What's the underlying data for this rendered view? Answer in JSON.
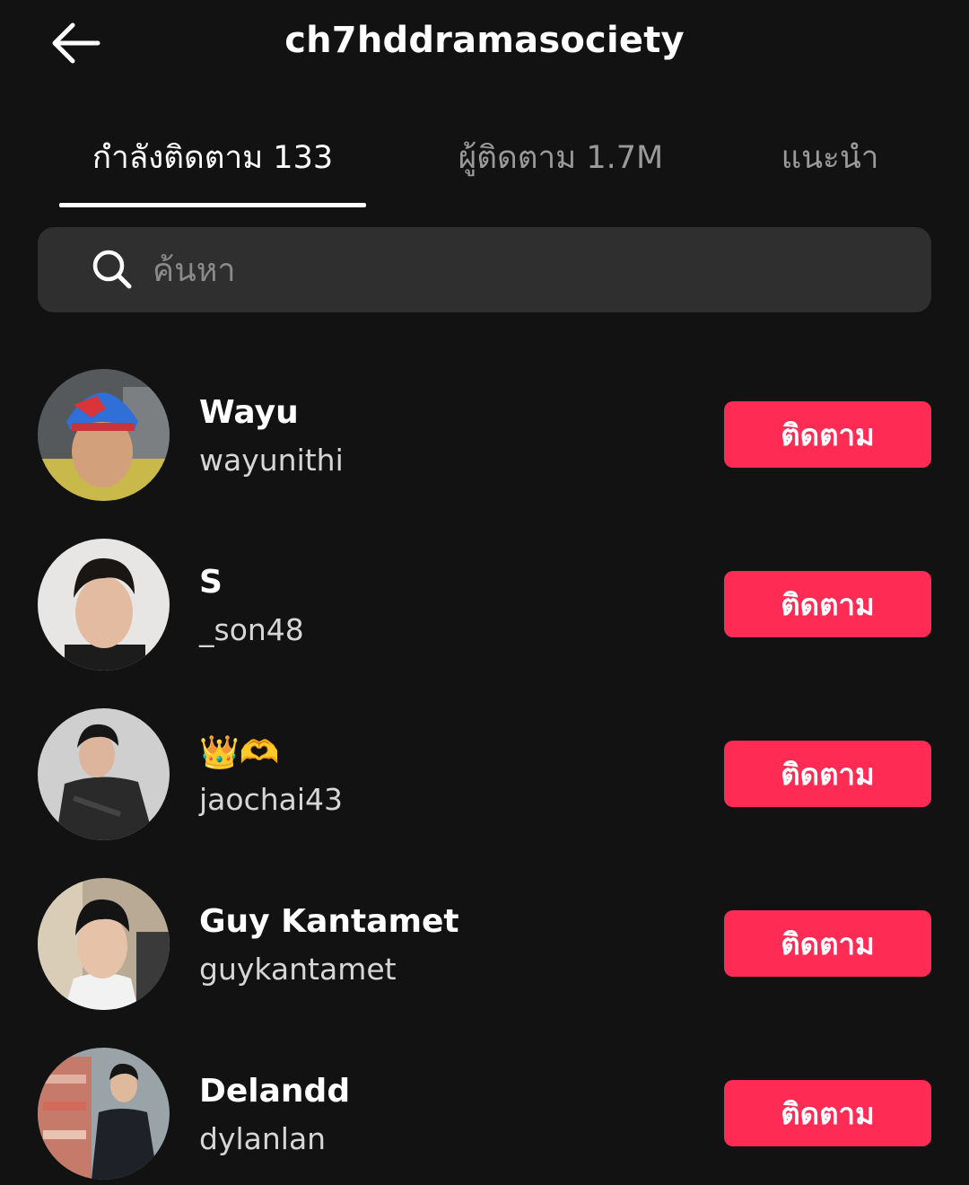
{
  "header": {
    "title": "ch7hddramasociety",
    "back_icon": "arrow-left-icon"
  },
  "tabs": [
    {
      "label": "กำลังติดตาม 133",
      "active": true
    },
    {
      "label": "ผู้ติดตาม 1.7M",
      "active": false
    },
    {
      "label": "แนะนำ",
      "active": false
    }
  ],
  "search": {
    "placeholder": "ค้นหา",
    "value": "",
    "icon": "search-icon"
  },
  "users": [
    {
      "name": "Wayu",
      "handle": "wayunithi",
      "button": "ติดตาม"
    },
    {
      "name": "S",
      "handle": "_son48",
      "button": "ติดตาม"
    },
    {
      "name": "👑🫶",
      "handle": "jaochai43",
      "button": "ติดตาม"
    },
    {
      "name": "Guy Kantamet",
      "handle": "guykantamet",
      "button": "ติดตาม"
    },
    {
      "name": "Delandd",
      "handle": "dylanlan",
      "button": "ติดตาม"
    }
  ],
  "colors": {
    "background": "#121212",
    "follow_button": "#fe2c55",
    "search_bg": "#2f2f2f",
    "inactive_tab": "#9a9a9a"
  }
}
